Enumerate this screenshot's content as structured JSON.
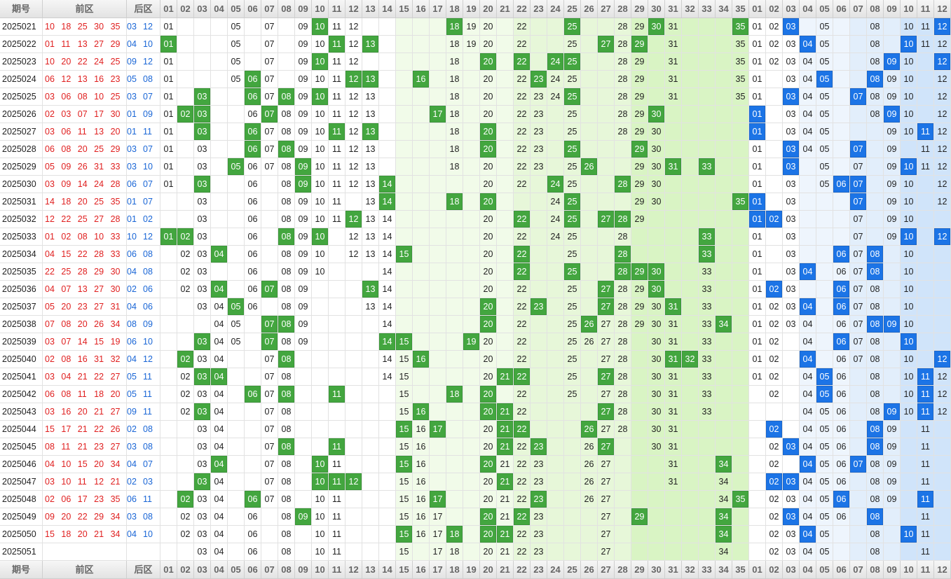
{
  "headers": {
    "period": "期号",
    "front_zone": "前区",
    "back_zone": "后区",
    "front_numbers": [
      "01",
      "02",
      "03",
      "04",
      "05",
      "06",
      "07",
      "08",
      "09",
      "10",
      "11",
      "12",
      "13",
      "14",
      "15",
      "16",
      "17",
      "18",
      "19",
      "20",
      "21",
      "22",
      "23",
      "24",
      "25",
      "26",
      "27",
      "28",
      "29",
      "30",
      "31",
      "32",
      "33",
      "34",
      "35"
    ],
    "back_numbers": [
      "01",
      "02",
      "03",
      "04",
      "05",
      "06",
      "07",
      "08",
      "09",
      "10",
      "11",
      "12"
    ]
  },
  "colors": {
    "front_hit": "#43a63f",
    "back_hit": "#1c74e6",
    "front_draw_text": "#e02020",
    "back_draw_text": "#1a66d6"
  },
  "rows": [
    {
      "period": "2025021",
      "front": [
        "10",
        "18",
        "25",
        "30",
        "35"
      ],
      "back": [
        "03",
        "12"
      ],
      "f": "01,05,07,09,10,11,12,18,19,20,22,28,29,31,35",
      "b": "01,02,03,05,08,10,11"
    },
    {
      "period": "2025022",
      "front": [
        "01",
        "11",
        "13",
        "27",
        "29"
      ],
      "back": [
        "04",
        "10"
      ],
      "f": "01,05,07,09,10,12,18,19,20,22,25,28,29,31,35",
      "b": "01,02,03,05,08,10,11,12"
    },
    {
      "period": "2025023",
      "front": [
        "10",
        "20",
        "22",
        "24",
        "25"
      ],
      "back": [
        "09",
        "12"
      ],
      "f": "01,05,07,09,10,11,12,18,20,22,28,29,31,35",
      "b": "01,02,03,04,05,08,10,12"
    },
    {
      "period": "2025024",
      "front": [
        "06",
        "12",
        "13",
        "16",
        "23"
      ],
      "back": [
        "05",
        "08"
      ],
      "f": "01,05,07,09,10,11,12,18,20,22,24,25,28,29,31,35",
      "b": "01,03,04,08,09,10,12"
    },
    {
      "period": "2025025",
      "front": [
        "03",
        "06",
        "08",
        "10",
        "25"
      ],
      "back": [
        "03",
        "07"
      ],
      "f": "01,07,09,10,11,12,13,18,20,22,23,24,25,28,29,31,35",
      "b": "01,03,04,05,08,09,10,12"
    },
    {
      "period": "2025026",
      "front": [
        "02",
        "03",
        "07",
        "17",
        "30"
      ],
      "back": [
        "01",
        "09"
      ],
      "f": "01,06,07,08,09,10,11,12,13,18,20,22,23,25,28,29",
      "b": "03,04,05,08,09,10,12"
    },
    {
      "period": "2025027",
      "front": [
        "03",
        "06",
        "11",
        "13",
        "20"
      ],
      "back": [
        "01",
        "11"
      ],
      "f": "01,03,06,07,08,09,10,11,12,13,18,20,22,23,25,28,29,30",
      "b": "01,03,04,05,09,10,12"
    },
    {
      "period": "2025028",
      "front": [
        "06",
        "08",
        "20",
        "25",
        "29"
      ],
      "back": [
        "03",
        "07"
      ],
      "f": "01,03,06,07,08,09,10,11,12,13,18,20,22,23,25,29,30",
      "b": "01,03,04,05,09,11,12"
    },
    {
      "period": "2025029",
      "front": [
        "05",
        "09",
        "26",
        "31",
        "33"
      ],
      "back": [
        "03",
        "10"
      ],
      "f": "01,03,06,07,08,10,11,12,13,18,20,22,23,25,29,30",
      "b": "01,03,05,07,09,11,12"
    },
    {
      "period": "2025030",
      "front": [
        "03",
        "09",
        "14",
        "24",
        "28"
      ],
      "back": [
        "06",
        "07"
      ],
      "f": "01,03,06,08,09,10,11,12,13,20,22,25,29,30",
      "b": "01,03,05,07,09,10,12"
    },
    {
      "period": "2025031",
      "front": [
        "14",
        "18",
        "20",
        "25",
        "35"
      ],
      "back": [
        "01",
        "07"
      ],
      "f": "03,06,08,09,10,11,13,20,24,25,29,30",
      "b": "01,03,07,09,10,12"
    },
    {
      "period": "2025032",
      "front": [
        "12",
        "22",
        "25",
        "27",
        "28"
      ],
      "back": [
        "01",
        "02"
      ],
      "f": "03,06,08,09,10,11,13,14,20,24,25,29",
      "b": "01,03,07,09,10"
    },
    {
      "period": "2025033",
      "front": [
        "01",
        "02",
        "08",
        "10",
        "33"
      ],
      "back": [
        "10",
        "12"
      ],
      "f": "03,06,08,09,10,12,13,14,20,22,24,25,28",
      "b": "01,03,07,09"
    },
    {
      "period": "2025034",
      "front": [
        "04",
        "15",
        "22",
        "28",
        "33"
      ],
      "back": [
        "06",
        "08"
      ],
      "f": "02,03,06,08,09,10,12,13,14,20,22,25,28,33",
      "b": "01,03,07,10"
    },
    {
      "period": "2025035",
      "front": [
        "22",
        "25",
        "28",
        "29",
        "30"
      ],
      "back": [
        "04",
        "08"
      ],
      "f": "02,03,06,08,09,10,14,20,22,25,28,33",
      "b": "01,03,06,07,10"
    },
    {
      "period": "2025036",
      "front": [
        "04",
        "07",
        "13",
        "27",
        "30"
      ],
      "back": [
        "02",
        "06"
      ],
      "f": "02,03,06,08,09,14,20,22,25,28,29,30,33",
      "b": "01,03,06,07,08,10"
    },
    {
      "period": "2025037",
      "front": [
        "05",
        "20",
        "23",
        "27",
        "31"
      ],
      "back": [
        "04",
        "06"
      ],
      "f": "03,04,06,08,09,13,14,20,22,25,27,28,29,30,33",
      "b": "01,02,03,06,07,08,10"
    },
    {
      "period": "2025038",
      "front": [
        "07",
        "08",
        "20",
        "26",
        "34"
      ],
      "back": [
        "08",
        "09"
      ],
      "f": "04,05,08,09,14,20,22,25,27,28,29,30,31,33",
      "b": "01,02,03,04,06,07,08,10"
    },
    {
      "period": "2025039",
      "front": [
        "03",
        "07",
        "14",
        "15",
        "19"
      ],
      "back": [
        "06",
        "10"
      ],
      "f": "04,05,07,08,09,14,20,22,25,26,27,28,30,31,33",
      "b": "01,02,04,06,07,08,10"
    },
    {
      "period": "2025040",
      "front": [
        "02",
        "08",
        "16",
        "31",
        "32"
      ],
      "back": [
        "04",
        "12"
      ],
      "f": "03,04,07,08,14,15,20,22,25,27,28,30,33",
      "b": "01,02,04,06,07,08,10"
    },
    {
      "period": "2025041",
      "front": [
        "03",
        "04",
        "21",
        "22",
        "27"
      ],
      "back": [
        "05",
        "11"
      ],
      "f": "02,04,07,08,14,15,20,22,25,27,28,30,31,33",
      "b": "01,02,04,06,08,10,12"
    },
    {
      "period": "2025042",
      "front": [
        "06",
        "08",
        "11",
        "18",
        "20"
      ],
      "back": [
        "05",
        "11"
      ],
      "f": "02,03,04,07,08,15,20,22,25,27,28,30,31,33",
      "b": "02,04,06,08,10,12"
    },
    {
      "period": "2025043",
      "front": [
        "03",
        "16",
        "20",
        "21",
        "27"
      ],
      "back": [
        "09",
        "11"
      ],
      "f": "02,03,04,07,08,15,20,22,27,28,30,31,33",
      "b": "04,05,06,08,10,11,12"
    },
    {
      "period": "2025044",
      "front": [
        "15",
        "17",
        "21",
        "22",
        "26"
      ],
      "back": [
        "02",
        "08"
      ],
      "f": "03,04,07,08,15,16,20,21,22,27,28,30,31",
      "b": "04,05,06,08,09,11"
    },
    {
      "period": "2025045",
      "front": [
        "08",
        "11",
        "21",
        "23",
        "27"
      ],
      "back": [
        "03",
        "08"
      ],
      "f": "03,04,07,08,15,16,20,21,22,26,27,30,31",
      "b": "02,04,05,06,08,09,11"
    },
    {
      "period": "2025046",
      "front": [
        "04",
        "10",
        "15",
        "20",
        "34"
      ],
      "back": [
        "04",
        "07"
      ],
      "f": "03,04,07,08,11,15,16,20,21,22,23,26,27,31",
      "b": "02,04,05,06,08,09,11"
    },
    {
      "period": "2025047",
      "front": [
        "03",
        "10",
        "11",
        "12",
        "21"
      ],
      "back": [
        "02",
        "03"
      ],
      "f": "03,04,07,08,11,15,16,20,21,22,23,26,27,31,34",
      "b": "04,05,06,08,09,11"
    },
    {
      "period": "2025048",
      "front": [
        "02",
        "06",
        "17",
        "23",
        "35"
      ],
      "back": [
        "06",
        "11"
      ],
      "f": "03,04,07,08,10,11,15,16,20,21,22,26,27,34",
      "b": "02,03,04,05,08,09,11"
    },
    {
      "period": "2025049",
      "front": [
        "09",
        "20",
        "22",
        "29",
        "34"
      ],
      "back": [
        "03",
        "08"
      ],
      "f": "02,03,04,06,08,10,11,15,16,17,20,21,22,23,27",
      "b": "02,03,04,05,06,08,11"
    },
    {
      "period": "2025050",
      "front": [
        "15",
        "18",
        "20",
        "21",
        "34"
      ],
      "back": [
        "04",
        "10"
      ],
      "f": "02,03,04,06,08,10,11,15,16,17,20,21,22,23,27,34",
      "b": "02,03,04,05,08,11"
    },
    {
      "period": "2025051",
      "front": [],
      "back": [],
      "f": "03,04,06,08,10,11,15,17,18,20,21,22,23,27,34",
      "b": "02,03,04,05,08,11"
    }
  ]
}
